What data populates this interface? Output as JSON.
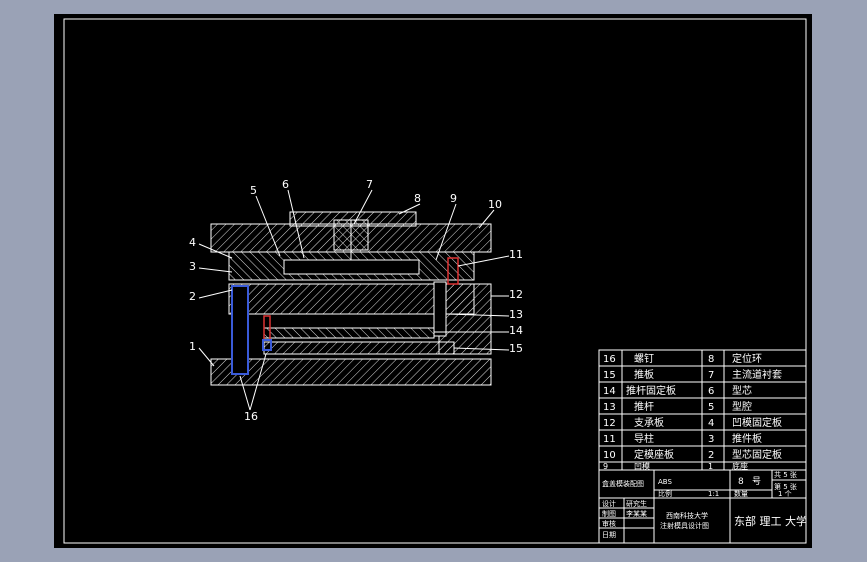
{
  "drawing": {
    "callouts": [
      "1",
      "2",
      "3",
      "4",
      "5",
      "6",
      "7",
      "8",
      "9",
      "10",
      "11",
      "12",
      "13",
      "14",
      "15",
      "16"
    ]
  },
  "parts_list": [
    {
      "no": "16",
      "name": "螺钉",
      "no2": "8",
      "name2": "定位环"
    },
    {
      "no": "15",
      "name": "推板",
      "no2": "7",
      "name2": "主流道衬套"
    },
    {
      "no": "14",
      "name": "推杆固定板",
      "no2": "6",
      "name2": "型芯"
    },
    {
      "no": "13",
      "name": "推杆",
      "no2": "5",
      "name2": "型腔"
    },
    {
      "no": "12",
      "name": "支承板",
      "no2": "4",
      "name2": "凹模固定板"
    },
    {
      "no": "11",
      "name": "导柱",
      "no2": "3",
      "name2": "推件板"
    },
    {
      "no": "10",
      "name": "定模座板",
      "no2": "2",
      "name2": "型芯固定板"
    },
    {
      "no": "9",
      "name": "凹模",
      "no2": "1",
      "name2": "底座"
    }
  ],
  "title_block": {
    "drawing_name": "盒盖模装配图",
    "material": "ABS",
    "quantity": "8",
    "unit": "号",
    "sheet_total": "共 5 张",
    "sheet_no": "第 5 张",
    "scale_label": "比例",
    "scale": "1:1",
    "weight_label": "数量",
    "weight": "1 个",
    "designer_label": "设计",
    "designer": "研究生",
    "drawer_label": "制图",
    "drawer": "李某某",
    "checker_label": "审核",
    "approver_label": "日期",
    "project": "西南科技大学",
    "project_sub": "注射模具设计图",
    "school": "东部 理工 大学"
  }
}
